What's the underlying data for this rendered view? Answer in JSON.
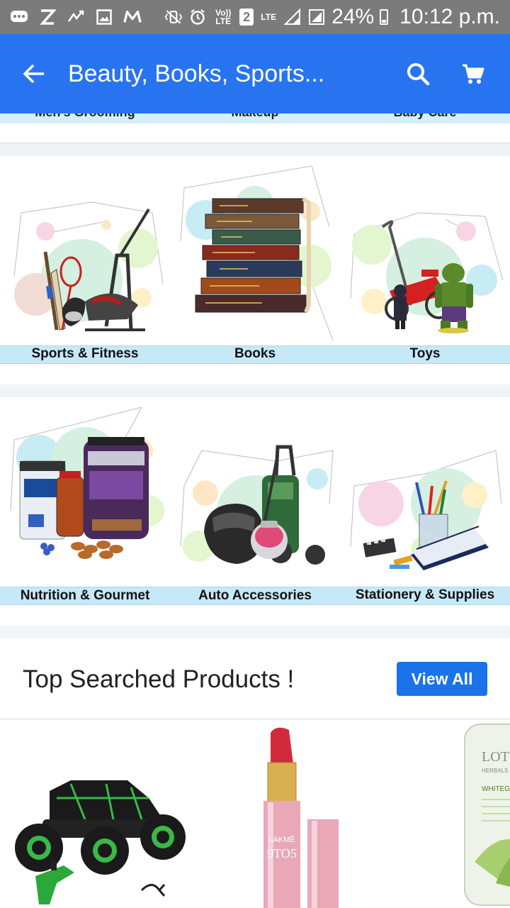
{
  "status_bar": {
    "battery_percent": "24%",
    "time": "10:12 p.m.",
    "sim_badge": "2",
    "volte_label": "Vo)) LTE",
    "lte_label": "LTE"
  },
  "app_bar": {
    "title": "Beauty, Books, Sports...",
    "icons": [
      "arrow-back-icon",
      "search-icon",
      "cart-icon"
    ],
    "color": "#2874f0"
  },
  "categories_top": [
    "Men's Grooming",
    "Makeup",
    "Baby Care"
  ],
  "category_rows": [
    [
      "Sports & Fitness",
      "Books",
      "Toys"
    ],
    [
      "Nutrition & Gourmet",
      "Auto Accessories",
      "Stationery & Supplies"
    ]
  ],
  "top_searched": {
    "heading": "Top Searched Products !",
    "view_all_label": "View All",
    "view_all_color": "#1a73e8"
  },
  "product_images": {
    "lipstick_brand": "LAKMĒ",
    "lipstick_line": "9TO5",
    "cream_brand": "LOTUS",
    "cream_sub": "HERBALS",
    "cream_line": "WHITEGLOW"
  }
}
